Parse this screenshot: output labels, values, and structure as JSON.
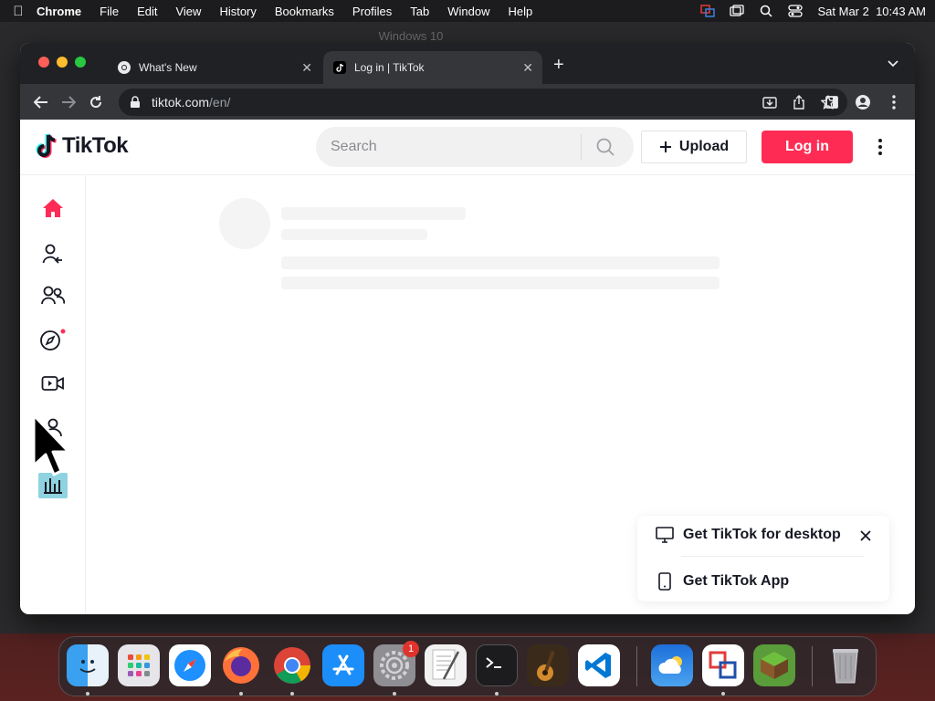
{
  "menubar": {
    "apple_icon": "apple-logo-icon",
    "app_name": "Chrome",
    "items": [
      "File",
      "Edit",
      "View",
      "History",
      "Bookmarks",
      "Profiles",
      "Tab",
      "Window",
      "Help"
    ],
    "datetime": "Sat Mar 2  10:43 AM",
    "status_icons": [
      "screen-share-icon",
      "window-icon",
      "search-icon",
      "control-center-icon"
    ]
  },
  "background_window": {
    "title": "Windows 10"
  },
  "browser": {
    "tabs": [
      {
        "label": "What's New",
        "icon": "chrome-icon",
        "active": false
      },
      {
        "label": "Log in | TikTok",
        "icon": "tiktok-icon",
        "active": true
      }
    ],
    "address": {
      "host": "tiktok.com",
      "path": "/en/"
    }
  },
  "tiktok": {
    "logo_text": "TikTok",
    "search_placeholder": "Search",
    "upload_label": "Upload",
    "login_label": "Log in",
    "brand_color": "#fe2c55",
    "sidebar_icons": [
      "home-icon",
      "following-icon",
      "friends-icon",
      "explore-icon",
      "live-icon",
      "profile-icon"
    ]
  },
  "promo": {
    "desktop_label": "Get TikTok for desktop",
    "app_label": "Get TikTok App"
  },
  "dock": {
    "apps": [
      "Finder",
      "Launchpad",
      "Safari",
      "Firefox",
      "Chrome",
      "App Store",
      "System Settings",
      "TextEdit",
      "Terminal",
      "GarageBand",
      "Visual Studio Code",
      "Weather",
      "Screen Sharing",
      "Minecraft",
      "Trash"
    ],
    "system_settings_badge": "1"
  }
}
